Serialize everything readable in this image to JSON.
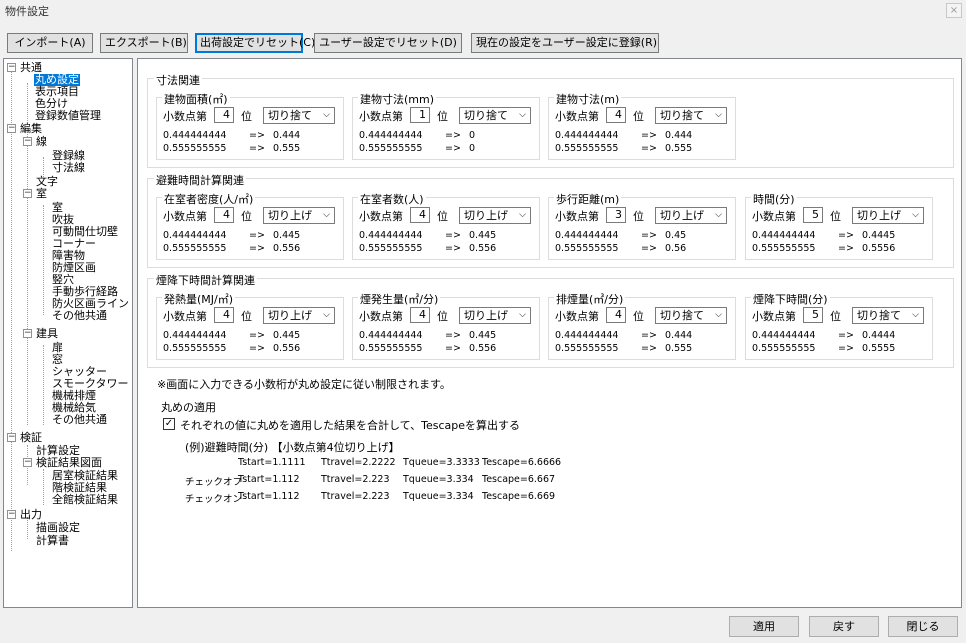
{
  "window": {
    "title": "物件設定",
    "close": "×"
  },
  "toolbar": {
    "import": "インポート(A)",
    "export": "エクスポート(B)",
    "reset_factory": "出荷設定でリセット(C)",
    "reset_user": "ユーザー設定でリセット(D)",
    "register_user": "現在の設定をユーザー設定に登録(R)"
  },
  "tree": {
    "common": "共通",
    "rounding": "丸め設定",
    "display_items": "表示項目",
    "color_coding": "色分け",
    "register_values": "登録数値管理",
    "edit": "編集",
    "line": "線",
    "register_line": "登録線",
    "dimension_line": "寸法線",
    "text": "文字",
    "room": "室",
    "room2": "室",
    "atrium": "吹抜",
    "movable_partition": "可動間仕切壁",
    "corner": "コーナー",
    "obstacle": "障害物",
    "smoke_zone": "防煙区画",
    "shaft": "竪穴",
    "walking_path": "手動歩行経路",
    "fire_zone_line": "防火区画ライン",
    "room_other": "その他共通",
    "fitting": "建具",
    "door": "扉",
    "window": "窓",
    "shutter": "シャッター",
    "smoke_tower": "スモークタワー",
    "mech_exhaust": "機械排煙",
    "mech_supply": "機械給気",
    "fitting_other": "その他共通",
    "verify": "検証",
    "calc_settings": "計算設定",
    "result_diagram": "検証結果図面",
    "room_result": "居室検証結果",
    "floor_result": "階検証結果",
    "building_result": "全館検証結果",
    "output": "出力",
    "draw_settings": "描画設定",
    "calc_report": "計算書"
  },
  "sections": {
    "dimension": "寸法関連",
    "evacuation": "避難時間計算関連",
    "smoke": "煙降下時間計算関連",
    "apply": "丸めの適用"
  },
  "common": {
    "decimal_prefix": "小数点第",
    "decimal_suffix": "位",
    "arrow": "=>",
    "sample1": "0.444444444",
    "sample2": "0.555555555"
  },
  "dim_fields": [
    {
      "title": "建物面積(㎡)",
      "digit": "4",
      "mode": "切り捨て",
      "r1": "0.444",
      "r2": "0.555"
    },
    {
      "title": "建物寸法(mm)",
      "digit": "1",
      "mode": "切り捨て",
      "r1": "0",
      "r2": "0"
    },
    {
      "title": "建物寸法(m)",
      "digit": "4",
      "mode": "切り捨て",
      "r1": "0.444",
      "r2": "0.555"
    }
  ],
  "evac_fields": [
    {
      "title": "在室者密度(人/㎡)",
      "digit": "4",
      "mode": "切り上げ",
      "r1": "0.445",
      "r2": "0.556"
    },
    {
      "title": "在室者数(人)",
      "digit": "4",
      "mode": "切り上げ",
      "r1": "0.445",
      "r2": "0.556"
    },
    {
      "title": "歩行距離(m)",
      "digit": "3",
      "mode": "切り上げ",
      "r1": "0.45",
      "r2": "0.56"
    },
    {
      "title": "時間(分)",
      "digit": "5",
      "mode": "切り上げ",
      "r1": "0.4445",
      "r2": "0.5556"
    }
  ],
  "smoke_fields": [
    {
      "title": "発熱量(MJ/㎡)",
      "digit": "4",
      "mode": "切り上げ",
      "r1": "0.445",
      "r2": "0.556"
    },
    {
      "title": "煙発生量(㎥/分)",
      "digit": "4",
      "mode": "切り上げ",
      "r1": "0.445",
      "r2": "0.556"
    },
    {
      "title": "排煙量(㎥/分)",
      "digit": "4",
      "mode": "切り捨て",
      "r1": "0.444",
      "r2": "0.555"
    },
    {
      "title": "煙降下時間(分)",
      "digit": "5",
      "mode": "切り捨て",
      "r1": "0.4444",
      "r2": "0.5555"
    }
  ],
  "note": "※画面に入力できる小数桁が丸め設定に従い制限されます。",
  "apply": {
    "checkbox_label": "それぞれの値に丸めを適用した結果を合計して、Tescapeを算出する",
    "checked": true,
    "example_title": "(例)避難時間(分) 【小数点第4位切り上げ】",
    "rows": [
      {
        "label": "",
        "tstart": "Tstart=1.1111",
        "ttravel": "Ttravel=2.2222",
        "tqueue": "Tqueue=3.3333",
        "tescape": "Tescape=6.6666"
      },
      {
        "label": "チェックオフ",
        "tstart": "Tstart=1.112",
        "ttravel": "Ttravel=2.223",
        "tqueue": "Tqueue=3.334",
        "tescape": "Tescape=6.667"
      },
      {
        "label": "チェックオン",
        "tstart": "Tstart=1.112",
        "ttravel": "Ttravel=2.223",
        "tqueue": "Tqueue=3.334",
        "tescape": "Tescape=6.669"
      }
    ]
  },
  "footer": {
    "apply": "適用",
    "revert": "戻す",
    "close": "閉じる"
  }
}
